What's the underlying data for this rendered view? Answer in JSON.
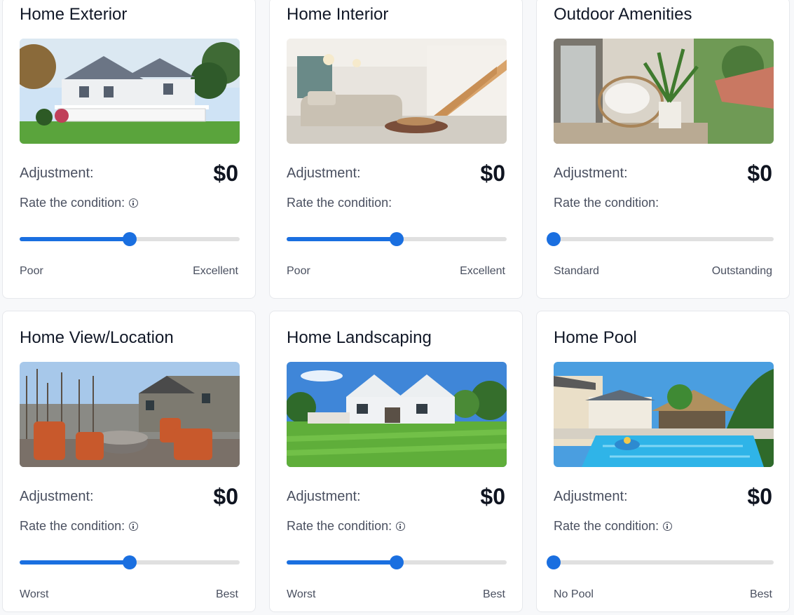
{
  "cards": [
    {
      "title": "Home Exterior",
      "image": "house-exterior-photo",
      "adjustment_label": "Adjustment:",
      "adjustment_value": "$0",
      "rate_label": "Rate the condition:",
      "has_info": true,
      "slider_value": 0.5,
      "min_label": "Poor",
      "max_label": "Excellent"
    },
    {
      "title": "Home Interior",
      "image": "living-room-interior-photo",
      "adjustment_label": "Adjustment:",
      "adjustment_value": "$0",
      "rate_label": "Rate the condition:",
      "has_info": false,
      "slider_value": 0.5,
      "min_label": "Poor",
      "max_label": "Excellent"
    },
    {
      "title": "Outdoor Amenities",
      "image": "porch-chair-plant-photo",
      "adjustment_label": "Adjustment:",
      "adjustment_value": "$0",
      "rate_label": "Rate the condition:",
      "has_info": false,
      "slider_value": 0.0,
      "min_label": "Standard",
      "max_label": "Outstanding"
    },
    {
      "title": "Home View/Location",
      "image": "patio-fire-pit-view-photo",
      "adjustment_label": "Adjustment:",
      "adjustment_value": "$0",
      "rate_label": "Rate the condition:",
      "has_info": true,
      "slider_value": 0.5,
      "min_label": "Worst",
      "max_label": "Best"
    },
    {
      "title": "Home Landscaping",
      "image": "lawn-house-landscape-photo",
      "adjustment_label": "Adjustment:",
      "adjustment_value": "$0",
      "rate_label": "Rate the condition:",
      "has_info": true,
      "slider_value": 0.5,
      "min_label": "Worst",
      "max_label": "Best"
    },
    {
      "title": "Home Pool",
      "image": "backyard-pool-photo",
      "adjustment_label": "Adjustment:",
      "adjustment_value": "$0",
      "rate_label": "Rate the condition:",
      "has_info": true,
      "slider_value": 0.0,
      "min_label": "No Pool",
      "max_label": "Best"
    }
  ],
  "colors": {
    "accent": "#1a6fe0",
    "track": "#e0e0e0"
  }
}
